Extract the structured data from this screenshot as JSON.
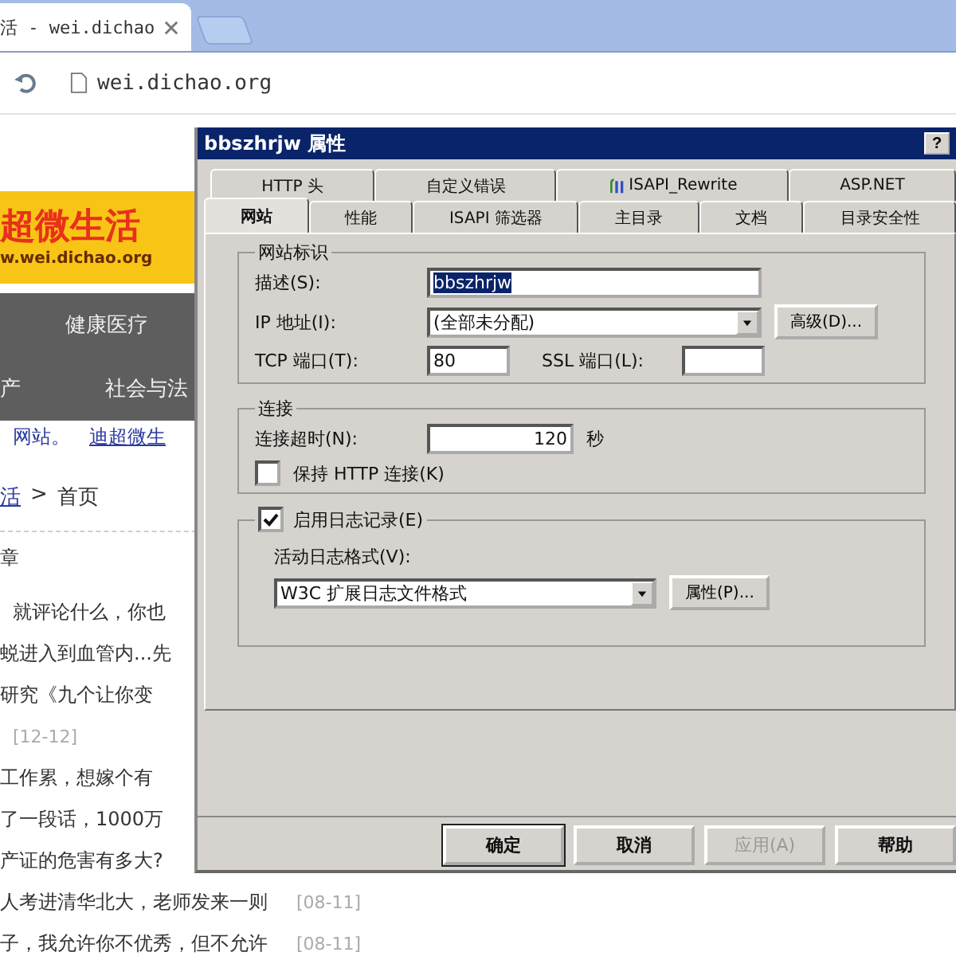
{
  "browser": {
    "tab_title": "活 - wei.dichao",
    "address": "wei.dichao.org"
  },
  "page": {
    "logo": "超微生活",
    "logo_url": "w.wei.dichao.org",
    "nav_rows": [
      [
        "健康医疗"
      ],
      [
        "产",
        "社会与法"
      ]
    ],
    "links": [
      "网站。",
      "迪超微生"
    ],
    "breadcrumb": {
      "link": "活",
      "separator": ">",
      "current": "首页"
    },
    "section": "章",
    "items": [
      {
        "text": "就评论什么，你也"
      },
      {
        "text": "蜕进入到血管内...先"
      },
      {
        "text": "研究《九个让你变"
      },
      {
        "date": "[12-12]"
      },
      {
        "text": "工作累，想嫁个有"
      },
      {
        "text": "了一段话，1000万"
      },
      {
        "text": "产证的危害有多大?"
      },
      {
        "text": "人考进清华北大，老师发来一则",
        "date": "[08-11]"
      },
      {
        "text": "子，我允许你不优秀，但不允许",
        "date": "[08-11]"
      }
    ]
  },
  "dialog": {
    "title": "bbszhrjw 属性",
    "help": "?",
    "tab_rows": [
      [
        {
          "label": "HTTP 头",
          "selected": false
        },
        {
          "label": "自定义错误",
          "selected": false
        },
        {
          "label": "ISAPI_Rewrite",
          "selected": false,
          "icon": true
        },
        {
          "label": "ASP.NET",
          "selected": false
        }
      ],
      [
        {
          "label": "网站",
          "selected": true
        },
        {
          "label": "性能",
          "selected": false
        },
        {
          "label": "ISAPI 筛选器",
          "selected": false
        },
        {
          "label": "主目录",
          "selected": false
        },
        {
          "label": "文档",
          "selected": false
        },
        {
          "label": "目录安全性",
          "selected": false
        }
      ]
    ],
    "identity": {
      "title": "网站标识",
      "description_label": "描述(S):",
      "description": "bbszhrjw",
      "ip_label": "IP 地址(I):",
      "ip": "(全部未分配)",
      "advanced": "高级(D)...",
      "tcp_label": "TCP 端口(T):",
      "tcp": "80",
      "ssl_label": "SSL 端口(L):"
    },
    "connection": {
      "title": "连接",
      "timeout_label": "连接超时(N):",
      "timeout": "120",
      "unit": "秒",
      "keepalive": {
        "label": "保持 HTTP 连接(K)",
        "checked": false
      }
    },
    "logging": {
      "enable": {
        "label": "启用日志记录(E)",
        "checked": true
      },
      "format_label": "活动日志格式(V):",
      "format": "W3C 扩展日志文件格式",
      "properties": "属性(P)..."
    },
    "buttons": [
      {
        "label": "确定",
        "default": true,
        "disabled": false
      },
      {
        "label": "取消",
        "default": false,
        "disabled": false
      },
      {
        "label": "应用(A)",
        "default": false,
        "disabled": true
      },
      {
        "label": "帮助",
        "default": false,
        "disabled": false
      }
    ]
  }
}
